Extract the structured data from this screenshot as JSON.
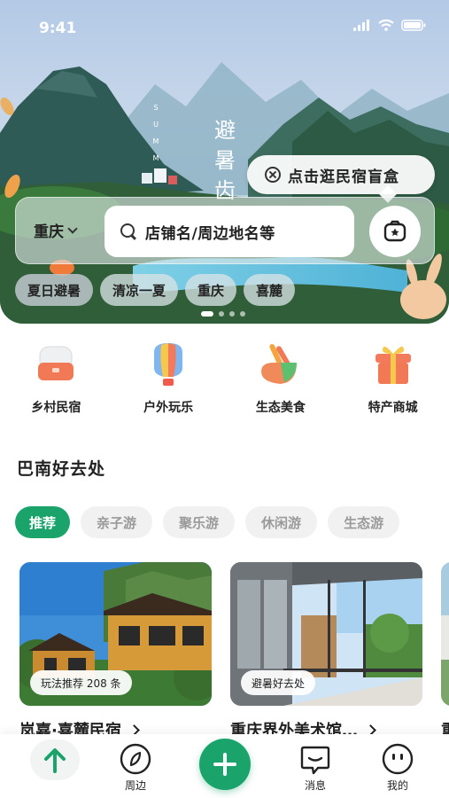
{
  "status_bar": {
    "time": "9:41"
  },
  "hero": {
    "vertical_title": [
      "避",
      "暑",
      "齿"
    ],
    "letters": [
      "S",
      "U",
      "M",
      "M"
    ],
    "blindbox_label": "点击逛民宿盲盒",
    "city": "重庆",
    "search_placeholder": "店铺名/周边地名等",
    "tags": [
      "夏日避暑",
      "清凉一夏",
      "重庆",
      "喜麓"
    ],
    "carousel_total": 4,
    "carousel_active": 1
  },
  "categories": [
    {
      "label": "乡村民宿",
      "icon": "homestay-icon"
    },
    {
      "label": "户外玩乐",
      "icon": "balloon-icon"
    },
    {
      "label": "生态美食",
      "icon": "food-icon"
    },
    {
      "label": "特产商城",
      "icon": "gift-icon"
    }
  ],
  "section": {
    "title": "巴南好去处",
    "filters": [
      "推荐",
      "亲子游",
      "聚乐游",
      "休闲游",
      "生态游"
    ],
    "active_filter": "推荐"
  },
  "cards": [
    {
      "badge": "玩法推荐 208 条",
      "title": "岚嘉·喜麓民宿"
    },
    {
      "badge": "避暑好去处",
      "title": "重庆界外美术馆…"
    }
  ],
  "peek_card_title": "重",
  "tabbar": {
    "home_icon": "arrow-up-icon",
    "nearby_label": "周边",
    "messages_label": "消息",
    "profile_label": "我的"
  },
  "colors": {
    "accent": "#1aa36b"
  }
}
